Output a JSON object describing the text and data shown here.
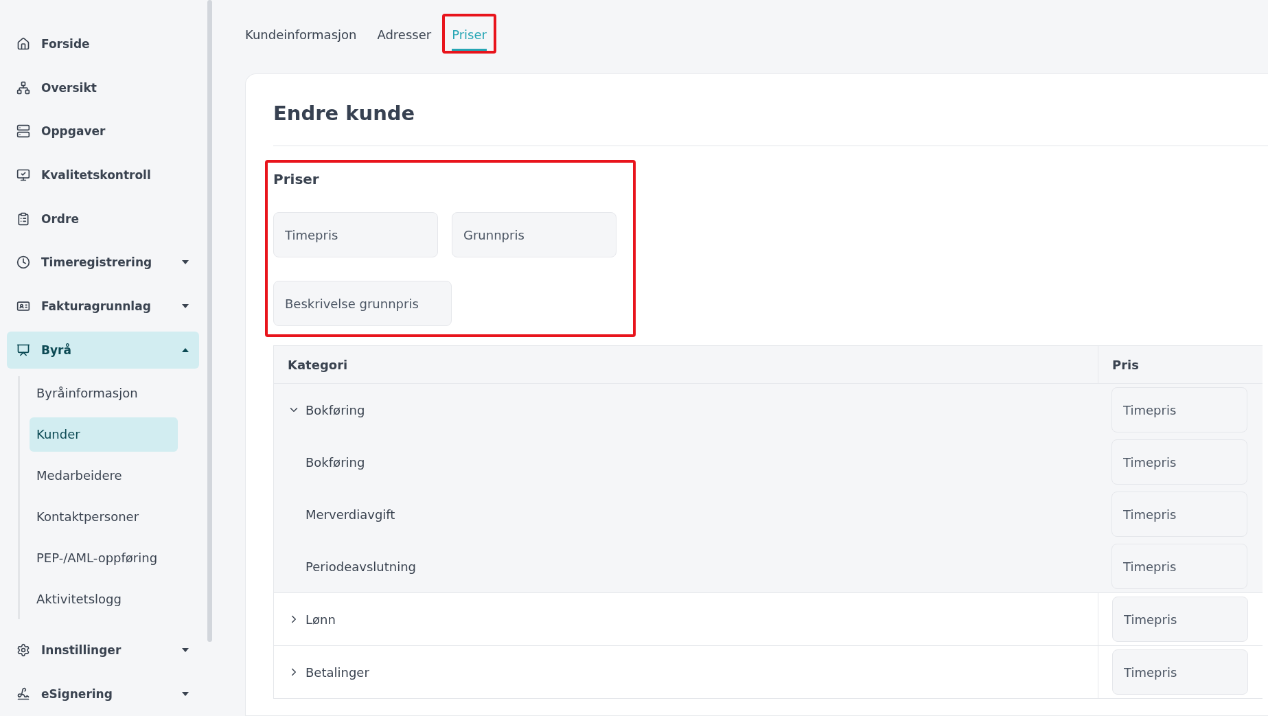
{
  "sidebar": {
    "items": [
      {
        "label": "Forside",
        "selected": false
      },
      {
        "label": "Oversikt",
        "selected": false
      },
      {
        "label": "Oppgaver",
        "selected": false
      },
      {
        "label": "Kvalitetskontroll",
        "selected": false
      },
      {
        "label": "Ordre",
        "selected": false
      },
      {
        "label": "Timeregistrering",
        "selected": false,
        "expanded": false
      },
      {
        "label": "Fakturagrunnlag",
        "selected": false,
        "expanded": false
      },
      {
        "label": "Byrå",
        "selected": true,
        "expanded": true,
        "children": [
          {
            "label": "Byråinformasjon",
            "selected": false
          },
          {
            "label": "Kunder",
            "selected": true
          },
          {
            "label": "Medarbeidere",
            "selected": false
          },
          {
            "label": "Kontaktpersoner",
            "selected": false
          },
          {
            "label": "PEP-/AML-oppføring",
            "selected": false
          },
          {
            "label": "Aktivitetslogg",
            "selected": false
          }
        ]
      },
      {
        "label": "Innstillinger",
        "selected": false,
        "expanded": false
      },
      {
        "label": "eSignering",
        "selected": false,
        "expanded": false
      }
    ]
  },
  "tabs": [
    {
      "label": "Kundeinformasjon",
      "selected": false,
      "highlighted": false
    },
    {
      "label": "Adresser",
      "selected": false,
      "highlighted": false
    },
    {
      "label": "Priser",
      "selected": true,
      "highlighted": true
    }
  ],
  "card": {
    "title": "Endre kunde",
    "prices": {
      "heading": "Priser",
      "highlighted": true,
      "fields": [
        {
          "placeholder": "Timepris"
        },
        {
          "placeholder": "Grunnpris"
        },
        {
          "placeholder": "Beskrivelse grunnpris"
        }
      ]
    },
    "table": {
      "columns": [
        "Kategori",
        "Pris"
      ],
      "rows": [
        {
          "label": "Bokføring",
          "price_placeholder": "Timepris",
          "expanded": true,
          "children": [
            {
              "label": "Bokføring",
              "price_placeholder": "Timepris"
            },
            {
              "label": "Merverdiavgift",
              "price_placeholder": "Timepris"
            },
            {
              "label": "Periodeavslutning",
              "price_placeholder": "Timepris"
            }
          ]
        },
        {
          "label": "Lønn",
          "price_placeholder": "Timepris",
          "expanded": false
        },
        {
          "label": "Betalinger",
          "price_placeholder": "Timepris",
          "expanded": false
        }
      ]
    }
  }
}
